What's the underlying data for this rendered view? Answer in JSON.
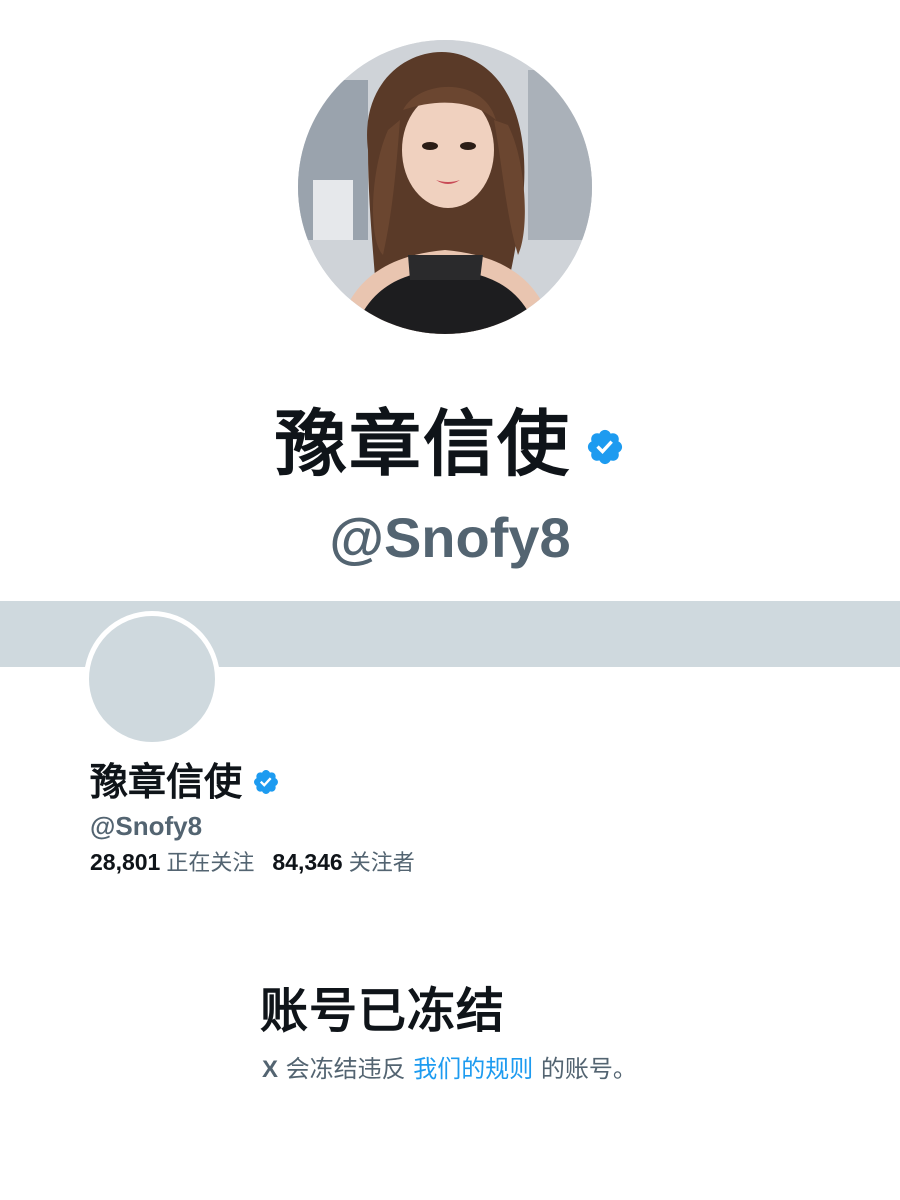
{
  "hero": {
    "display_name": "豫章信使",
    "handle": "@Snofy8"
  },
  "profile": {
    "display_name": "豫章信使",
    "handle": "@Snofy8",
    "stats": {
      "following_count": "28,801",
      "following_label": "正在关注",
      "followers_count": "84,346",
      "followers_label": "关注者"
    }
  },
  "notice": {
    "title": "账号已冻结",
    "prefix_x": "X",
    "prefix_text": " 会冻结违反 ",
    "rules_link": "我们的规则",
    "suffix_text": " 的账号。"
  },
  "colors": {
    "verified_blue": "#1d9bf0",
    "banner_gray": "#cfd9de",
    "secondary_text": "#536471",
    "primary_text": "#0f1419"
  },
  "icons": {
    "verified": "verified-badge-icon"
  }
}
